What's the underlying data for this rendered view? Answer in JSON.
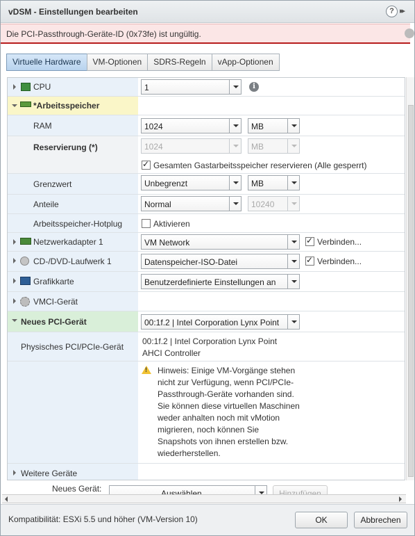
{
  "dialog": {
    "title": "vDSM - Einstellungen bearbeiten",
    "help_glyph": "?",
    "expand_glyph": "▸▸"
  },
  "error": {
    "message": "Die PCI-Passthrough-Geräte-ID (0x73fe) ist ungültig."
  },
  "tabs": [
    {
      "label": "Virtuelle Hardware",
      "active": true
    },
    {
      "label": "VM-Optionen"
    },
    {
      "label": "SDRS-Regeln"
    },
    {
      "label": "vApp-Optionen"
    }
  ],
  "hardware": {
    "cpu": {
      "label": "CPU",
      "value": "1",
      "info_glyph": "i"
    },
    "memory": {
      "label": "*Arbeitsspeicher",
      "ram": {
        "label": "RAM",
        "value": "1024",
        "unit": "MB"
      },
      "reservation": {
        "label": "Reservierung (*)",
        "value": "1024",
        "unit": "MB",
        "checkbox_label": "Gesamten Gastarbeitsspeicher reservieren (Alle gesperrt)",
        "checked": true
      },
      "limit": {
        "label": "Grenzwert",
        "value": "Unbegrenzt",
        "unit": "MB"
      },
      "shares": {
        "label": "Anteile",
        "value": "Normal",
        "amount": "10240"
      },
      "hotplug": {
        "label": "Arbeitsspeicher-Hotplug",
        "checkbox_label": "Aktivieren",
        "checked": false
      }
    },
    "network": {
      "label": "Netzwerkadapter 1",
      "value": "VM Network",
      "connect_label": "Verbinden...",
      "connect_checked": true
    },
    "cdrom": {
      "label": "CD-/DVD-Laufwerk 1",
      "value": "Datenspeicher-ISO-Datei",
      "connect_label": "Verbinden...",
      "connect_checked": true
    },
    "video": {
      "label": "Grafikkarte",
      "value": "Benutzerdefinierte Einstellungen an"
    },
    "vmci": {
      "label": "VMCI-Gerät"
    },
    "pci": {
      "label": "Neues PCI-Gerät",
      "value": "00:1f.2 | Intel Corporation Lynx Point",
      "physical_label": "Physisches PCI/PCIe-Gerät",
      "physical_line1": "00:1f.2 | Intel Corporation Lynx Point",
      "physical_line2": "AHCI Controller",
      "note_lines": [
        "Hinweis: Einige VM-Vorgänge stehen",
        "nicht zur Verfügung, wenn PCI/PCIe-",
        "Passthrough-Geräte vorhanden sind.",
        "Sie können diese virtuellen Maschinen",
        "weder anhalten noch mit vMotion",
        "migrieren, noch können Sie",
        "Snapshots von ihnen erstellen bzw.",
        "wiederherstellen."
      ]
    },
    "other": {
      "label": "Weitere Geräte"
    }
  },
  "new_device": {
    "label": "Neues Gerät:",
    "select_value": "Auswählen",
    "add_label": "Hinzufügen"
  },
  "footer": {
    "compat": "Kompatibilität: ESXi 5.5 und höher (VM-Version 10)",
    "ok": "OK",
    "cancel": "Abbrechen"
  }
}
